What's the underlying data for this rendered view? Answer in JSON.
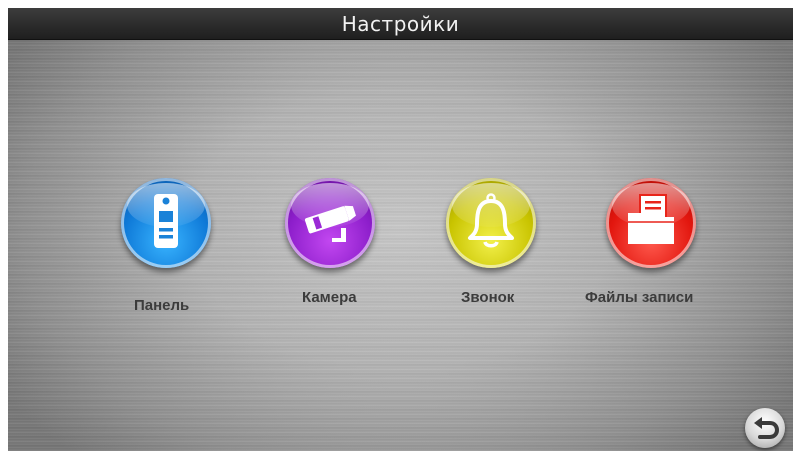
{
  "header": {
    "title": "Настройки"
  },
  "menu": [
    {
      "id": "panel",
      "label": "Панель",
      "icon": "door-panel-icon",
      "color": "#1a8ae6"
    },
    {
      "id": "camera",
      "label": "Камера",
      "icon": "cctv-camera-icon",
      "color": "#9b2ad6"
    },
    {
      "id": "bell",
      "label": "Звонок",
      "icon": "bell-icon",
      "color": "#d9d400"
    },
    {
      "id": "files",
      "label": "Файлы записи",
      "icon": "folder-document-icon",
      "color": "#e8241a"
    }
  ],
  "footer": {
    "back_icon": "back-arrow-icon"
  }
}
